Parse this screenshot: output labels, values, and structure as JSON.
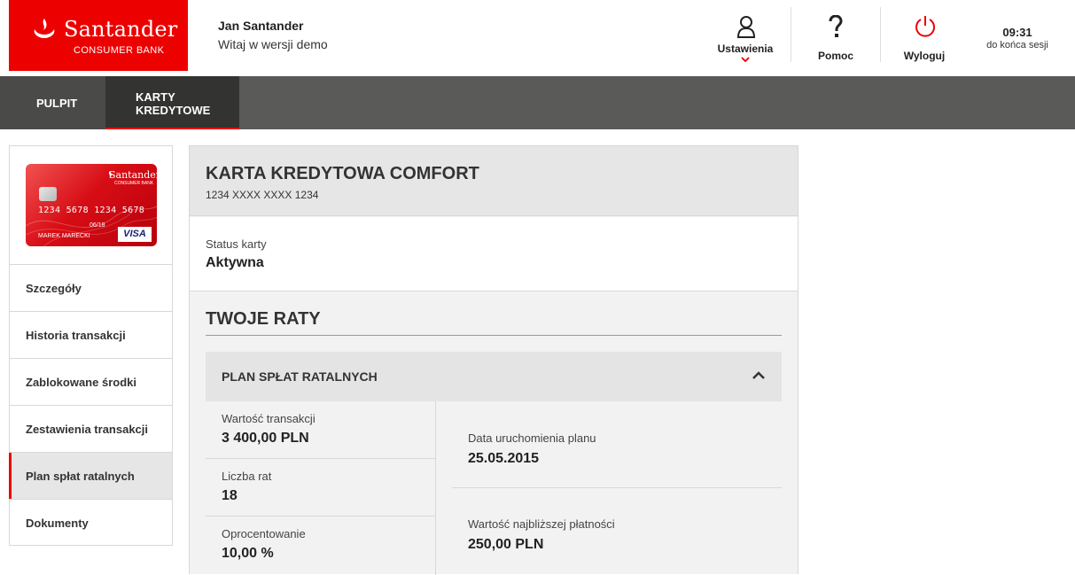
{
  "header": {
    "brand": "Santander",
    "brand_sub": "CONSUMER BANK",
    "user_name": "Jan Santander",
    "greeting": "Witaj w wersji demo",
    "settings_label": "Ustawienia",
    "help_label": "Pomoc",
    "logout_label": "Wyloguj",
    "session_time": "09:31",
    "session_text": "do końca sesji",
    "accent_color": "#ec0000"
  },
  "nav": {
    "tabs": [
      {
        "label": "PULPIT"
      },
      {
        "label": "KARTY\nKREDYTOWE"
      }
    ]
  },
  "sidebar": {
    "card": {
      "brand": "Santander",
      "brand_sub": "CONSUMER BANK",
      "number": "1234 5678 1234 5678",
      "expiry": "06/18",
      "holder": "MAREK MARECKI",
      "network": "VISA"
    },
    "items": [
      {
        "label": "Szczegóły"
      },
      {
        "label": "Historia transakcji"
      },
      {
        "label": "Zablokowane środki"
      },
      {
        "label": "Zestawienia transakcji"
      },
      {
        "label": "Plan spłat ratalnych"
      },
      {
        "label": "Dokumenty"
      }
    ]
  },
  "main": {
    "title": "KARTA KREDYTOWA COMFORT",
    "card_number": "1234 XXXX XXXX 1234",
    "status_label": "Status karty",
    "status_value": "Aktywna",
    "installments_title": "TWOJE RATY",
    "plan_title": "PLAN SPŁAT RATALNYCH",
    "left_fields": [
      {
        "label": "Wartość transakcji",
        "value": "3 400,00 PLN"
      },
      {
        "label": "Liczba rat",
        "value": "18"
      },
      {
        "label": "Oprocentowanie",
        "value": "10,00 %"
      }
    ],
    "right_fields": [
      {
        "label": "Data uruchomienia planu",
        "value": "25.05.2015"
      },
      {
        "label": "Wartość najbliższej płatności",
        "value": "250,00 PLN"
      }
    ]
  }
}
